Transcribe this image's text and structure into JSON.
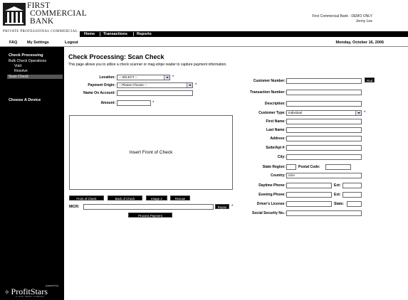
{
  "brand": {
    "name_line1": "First",
    "name_line2": "Commercial",
    "name_line3": "Bank",
    "tagline": "Private  Professional  Commercial"
  },
  "site_info": {
    "site": "First Commercial Bank - DEMO ONLY",
    "user": "Jenny Lee"
  },
  "top_nav": [
    "Home",
    "Transactions",
    "Reports"
  ],
  "sub_nav": {
    "faq": "FAQ",
    "settings": "My Settings",
    "logout": "Logout",
    "date": "Monday, October 16, 2006"
  },
  "sidebar": {
    "heading": "Check Processing",
    "items": [
      "Bulk Check Operations",
      "Void",
      "Resolve",
      "Scan Check"
    ],
    "device_heading": "Choose A Device",
    "powered_by": "powered by",
    "logo": "ProfitStars",
    "logo_sub": "A JACK HENRY COMPANY"
  },
  "page": {
    "title": "Check Processing: Scan Check",
    "description": "This page allows you to utilize a check scanner or mag-stripe reader to capture payment information."
  },
  "left_form": {
    "location_label": "Location:",
    "location_value": "-- SELECT --",
    "payment_origin_label": "Payment Origin:",
    "payment_origin_value": "-- Please Choose --",
    "name_label": "Name On Account:",
    "amount_label": "Amount:",
    "required_mark": "*"
  },
  "check_image": {
    "placeholder": "Insert Front of Check"
  },
  "image_buttons": [
    "Front of Check",
    "Back of Check",
    "Image 2",
    "Rescan"
  ],
  "micr": {
    "label": "MICR:",
    "repair": "Repair",
    "process": "Process Payment"
  },
  "right_form": {
    "customer_number_label": "Customer Number:",
    "find": "Find",
    "transaction_number_label": "Transaction Number:",
    "description_label": "Description:",
    "customer_type_label": "Customer Type:",
    "customer_type_value": "Individual",
    "first_name_label": "First Name:",
    "last_name_label": "Last Name:",
    "address_label": "Address:",
    "suite_label": "Suite/Apt #:",
    "city_label": "City:",
    "state_label": "State Region:",
    "postal_label": "Postal Code:",
    "country_label": "Country:",
    "country_value": "USA",
    "day_phone_label": "Daytime Phone:",
    "eve_phone_label": "Evening Phone:",
    "ext_label": "Ext:",
    "license_label": "Driver's License:",
    "license_state_label": "State:",
    "ssn_label": "Social Security No.:"
  }
}
